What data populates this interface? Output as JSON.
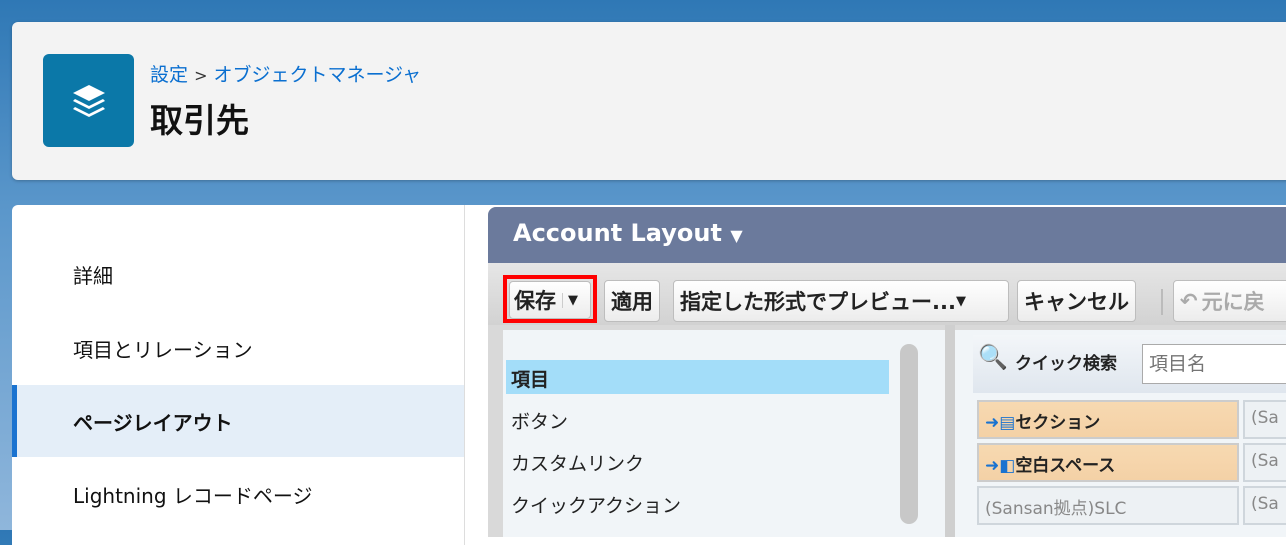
{
  "header": {
    "breadcrumb": [
      "設定",
      "オブジェクトマネージャ"
    ],
    "separator": ">",
    "title": "取引先",
    "icon": "layers-icon"
  },
  "sidebar": {
    "items": [
      {
        "label": "詳細"
      },
      {
        "label": "項目とリレーション"
      },
      {
        "label": "ページレイアウト",
        "active": true
      },
      {
        "label": "Lightning レコードページ"
      }
    ]
  },
  "layout": {
    "title": "Account Layout",
    "toolbar": {
      "save": "保存",
      "apply": "適用",
      "preview": "指定した形式でプレビュー...",
      "cancel": "キャンセル",
      "undo": "元に戻"
    },
    "palette": {
      "categories": [
        "項目",
        "ボタン",
        "カスタムリンク",
        "クイックアクション"
      ],
      "selected": "項目",
      "quick_find_label": "クイック検索",
      "quick_find_placeholder": "項目名",
      "cells": [
        [
          "セクション",
          "(Sa"
        ],
        [
          "空白スペース",
          "(Sa"
        ],
        [
          "(Sansan拠点)SLC",
          "(Sa"
        ]
      ]
    }
  },
  "colors": {
    "accent": "#0b78a8",
    "highlight": "#ff0000"
  }
}
